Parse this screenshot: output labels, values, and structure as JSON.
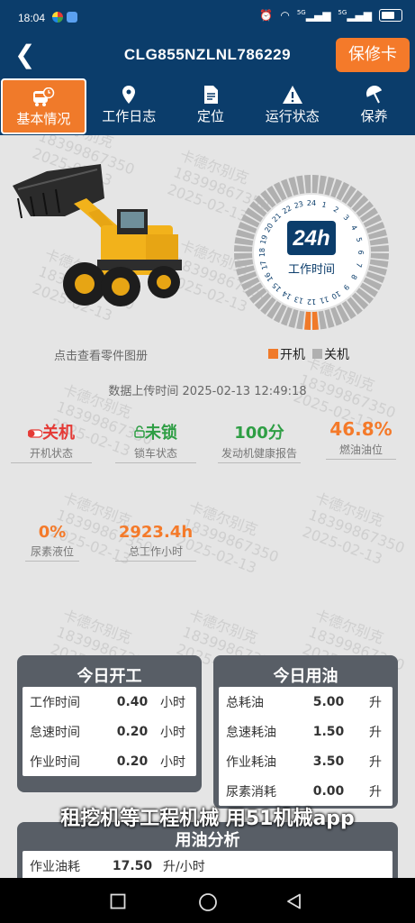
{
  "status_bar": {
    "time": "18:04",
    "signal_1": "5G",
    "signal_2": "5G"
  },
  "header": {
    "title": "CLG855NZLNL786229",
    "warranty_button": "保修卡"
  },
  "tabs": [
    {
      "label": "基本情况",
      "icon": "bus-clock-icon"
    },
    {
      "label": "工作日志",
      "icon": "map-pin-icon"
    },
    {
      "label": "定位",
      "icon": "document-icon"
    },
    {
      "label": "运行状态",
      "icon": "warning-icon"
    },
    {
      "label": "保养",
      "icon": "umbrella-icon"
    }
  ],
  "dial": {
    "center_label": "24h",
    "caption": "工作时间",
    "hours": [
      "24",
      "1",
      "2",
      "3",
      "4",
      "5",
      "6",
      "7",
      "8",
      "9",
      "10",
      "11",
      "12",
      "13",
      "14",
      "15",
      "16",
      "17",
      "18",
      "19",
      "20",
      "21",
      "22",
      "23"
    ],
    "active_segments": 2
  },
  "legend": {
    "on": "开机",
    "off": "关机"
  },
  "parts_link": "点击查看零件图册",
  "upload_time": "数据上传时间 2025-02-13 12:49:18",
  "stats": {
    "power": {
      "value": "关机",
      "label": "开机状态"
    },
    "lock": {
      "value": "未锁",
      "label": "锁车状态"
    },
    "health": {
      "value": "100分",
      "label": "发动机健康报告"
    },
    "fuel": {
      "value": "46.8%",
      "label": "燃油油位"
    },
    "urea": {
      "value": "0%",
      "label": "尿素液位"
    },
    "hours": {
      "value": "2923.4h",
      "label": "总工作小时"
    }
  },
  "today_work": {
    "title": "今日开工",
    "rows": [
      {
        "label": "工作时间",
        "value": "0.40",
        "unit": "小时"
      },
      {
        "label": "怠速时间",
        "value": "0.20",
        "unit": "小时"
      },
      {
        "label": "作业时间",
        "value": "0.20",
        "unit": "小时"
      }
    ]
  },
  "today_fuel": {
    "title": "今日用油",
    "rows": [
      {
        "label": "总耗油",
        "value": "5.00",
        "unit": "升"
      },
      {
        "label": "怠速耗油",
        "value": "1.50",
        "unit": "升"
      },
      {
        "label": "作业耗油",
        "value": "3.50",
        "unit": "升"
      },
      {
        "label": "尿素消耗",
        "value": "0.00",
        "unit": "升"
      }
    ]
  },
  "fuel_analysis": {
    "title": "用油分析",
    "row": {
      "label": "作业油耗",
      "value": "17.50",
      "unit": "升/小时"
    }
  },
  "banner": "租挖机等工程机械 用51机械app",
  "watermark": {
    "line1": "卡德尔别克",
    "line2": "18399867350",
    "line3": "2025-02-13"
  },
  "colors": {
    "primary": "#0b3d6b",
    "accent": "#f47a2a",
    "on": "#f07a2a",
    "off": "#b0b0b0",
    "red": "#e53935",
    "green": "#2e9e44"
  }
}
